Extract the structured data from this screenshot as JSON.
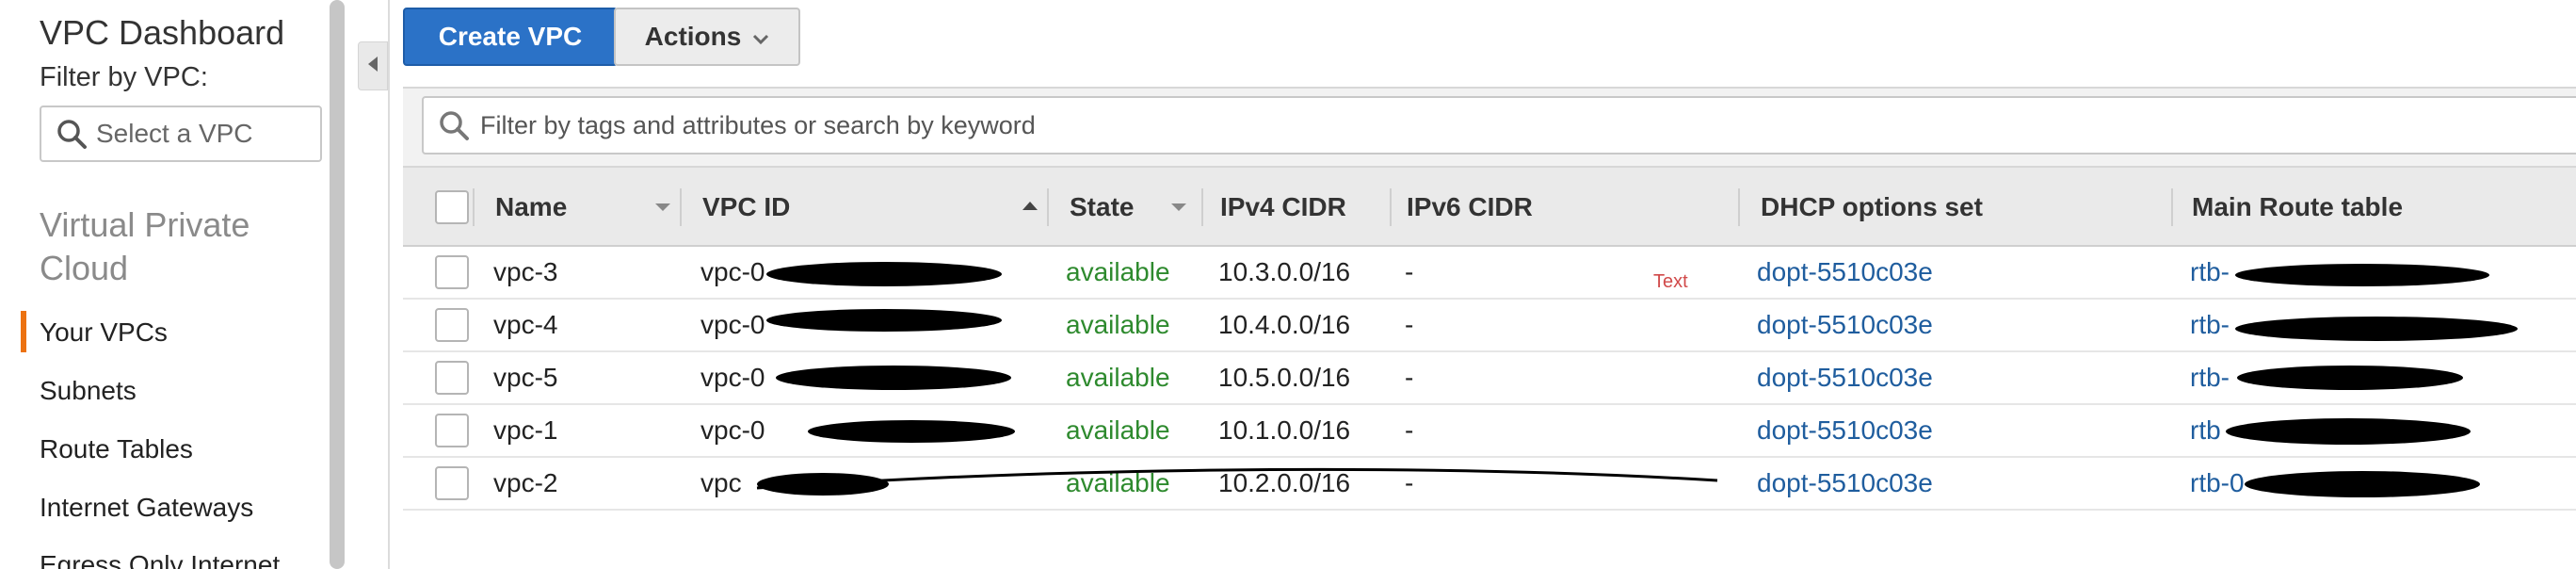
{
  "sidebar": {
    "title": "VPC Dashboard",
    "filter_label": "Filter by VPC:",
    "select_placeholder": "Select a VPC",
    "section_title": "Virtual Private Cloud",
    "nav": [
      {
        "label": "Your VPCs",
        "active": true
      },
      {
        "label": "Subnets"
      },
      {
        "label": "Route Tables"
      },
      {
        "label": "Internet Gateways"
      },
      {
        "label": "Egress Only Internet"
      }
    ]
  },
  "toolbar": {
    "create_label": "Create VPC",
    "actions_label": "Actions"
  },
  "search": {
    "placeholder": "Filter by tags and attributes or search by keyword"
  },
  "table": {
    "columns": [
      "Name",
      "VPC ID",
      "State",
      "IPv4 CIDR",
      "IPv6 CIDR",
      "DHCP options set",
      "Main Route table"
    ],
    "rows": [
      {
        "name": "vpc-3",
        "vpc_id": "vpc-0",
        "state": "available",
        "ipv4": "10.3.0.0/16",
        "ipv6": "-",
        "dhcp": "dopt-5510c03e",
        "route": "rtb-"
      },
      {
        "name": "vpc-4",
        "vpc_id": "vpc-0",
        "state": "available",
        "ipv4": "10.4.0.0/16",
        "ipv6": "-",
        "dhcp": "dopt-5510c03e",
        "route": "rtb-"
      },
      {
        "name": "vpc-5",
        "vpc_id": "vpc-0",
        "state": "available",
        "ipv4": "10.5.0.0/16",
        "ipv6": "-",
        "dhcp": "dopt-5510c03e",
        "route": "rtb-"
      },
      {
        "name": "vpc-1",
        "vpc_id": "vpc-0",
        "state": "available",
        "ipv4": "10.1.0.0/16",
        "ipv6": "-",
        "dhcp": "dopt-5510c03e",
        "route": "rtb"
      },
      {
        "name": "vpc-2",
        "vpc_id": "vpc",
        "state": "available",
        "ipv4": "10.2.0.0/16",
        "ipv6": "-",
        "dhcp": "dopt-5510c03e",
        "route": "rtb-0"
      }
    ]
  },
  "stray_text": "Text",
  "colors": {
    "primary_button": "#2b72c7",
    "active_nav_marker": "#ec7211",
    "state_available": "#2e8a2e",
    "link": "#1f5d9e"
  }
}
